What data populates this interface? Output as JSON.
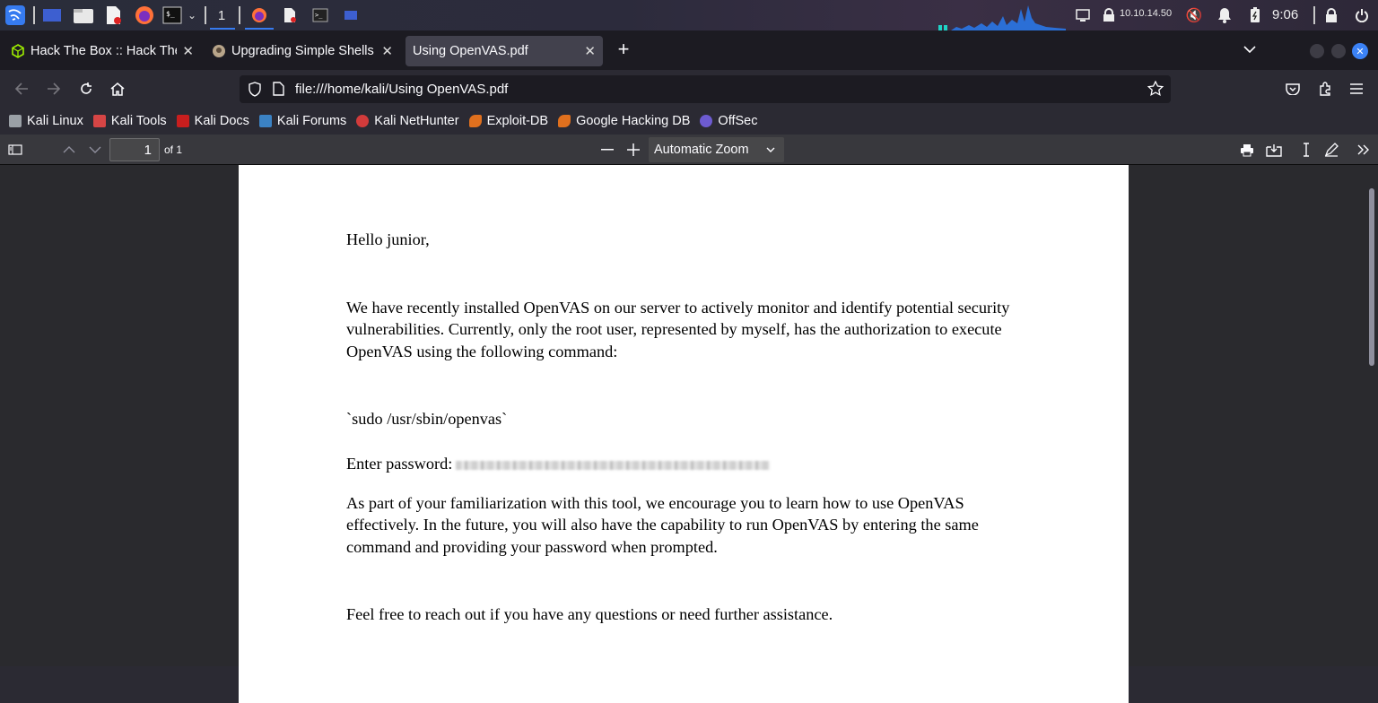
{
  "taskbar": {
    "workspace": "1",
    "ip": "10.10.14.50",
    "time": "9:06"
  },
  "tabs": [
    {
      "label": "Hack The Box :: Hack The",
      "icon": "hackthebox-icon"
    },
    {
      "label": "Upgrading Simple Shells",
      "icon": "avatar-icon"
    },
    {
      "label": "Using OpenVAS.pdf",
      "icon": "",
      "active": true
    }
  ],
  "urlbar": {
    "url": "file:///home/kali/Using OpenVAS.pdf"
  },
  "bookmarks": [
    {
      "label": "Kali Linux",
      "color": "#9aa0a6"
    },
    {
      "label": "Kali Tools",
      "color": "#d64545"
    },
    {
      "label": "Kali Docs",
      "color": "#c81e1e"
    },
    {
      "label": "Kali Forums",
      "color": "#3b82c4"
    },
    {
      "label": "Kali NetHunter",
      "color": "#d23b3b"
    },
    {
      "label": "Exploit-DB",
      "color": "#e0701e"
    },
    {
      "label": "Google Hacking DB",
      "color": "#e0701e"
    },
    {
      "label": "OffSec",
      "color": "#6d5bd0"
    }
  ],
  "pdf_toolbar": {
    "page": "1",
    "of_pages": "of 1",
    "zoom": "Automatic Zoom"
  },
  "document": {
    "greeting": "Hello junior,",
    "para1": "We have recently installed OpenVAS on our server to actively monitor and identify potential security vulnerabilities. Currently, only the root user, represented by myself, has the authorization to execute OpenVAS using the following command:",
    "command": "`sudo /usr/sbin/openvas`",
    "password_label": "Enter password:",
    "para2": "As part of your familiarization with this tool, we encourage you to learn how to use OpenVAS effectively. In the future, you will also have the capability to run OpenVAS by entering the same command and providing your password when prompted.",
    "para3": "Feel free to reach out if you have any questions or need further assistance."
  },
  "colors": {
    "accent": "#0060df",
    "tab_active": "#42414d",
    "page_bg": "#ffffff"
  }
}
